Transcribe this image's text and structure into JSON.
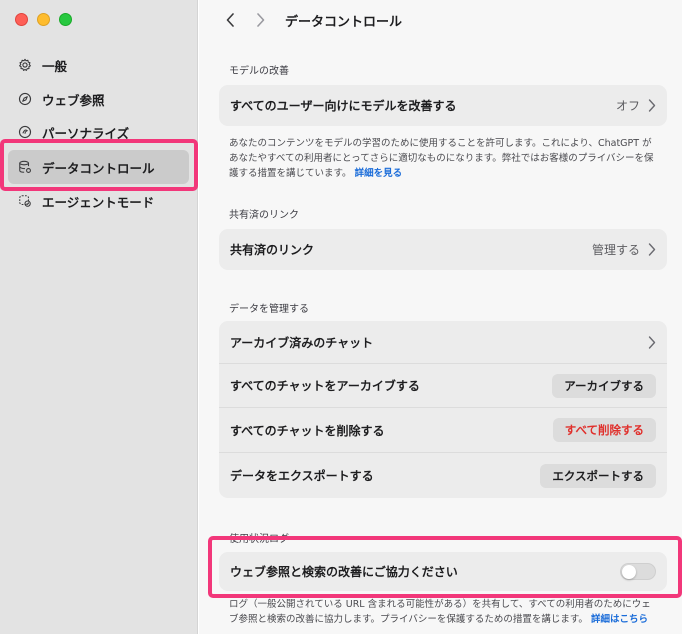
{
  "sidebar": {
    "items": [
      {
        "label": "一般",
        "icon": "gear-icon"
      },
      {
        "label": "ウェブ参照",
        "icon": "compass-icon"
      },
      {
        "label": "パーソナライズ",
        "icon": "personalize-icon"
      },
      {
        "label": "データコントロール",
        "icon": "database-gear-icon"
      },
      {
        "label": "エージェントモード",
        "icon": "agent-icon"
      }
    ]
  },
  "header": {
    "title": "データコントロール"
  },
  "model": {
    "section_label": "モデルの改善",
    "row_label": "すべてのユーザー向けにモデルを改善する",
    "row_value": "オフ",
    "desc": "あなたのコンテンツをモデルの学習のために使用することを許可します。これにより、ChatGPT があなたやすべての利用者にとってさらに適切なものになります。弊社ではお客様のプライバシーを保護する措置を講じています。",
    "link": "詳細を見る"
  },
  "shared": {
    "section_label": "共有済のリンク",
    "row_label": "共有済のリンク",
    "row_value": "管理する"
  },
  "manage": {
    "section_label": "データを管理する",
    "archived_label": "アーカイブ済みのチャット",
    "archive_all_label": "すべてのチャットをアーカイブする",
    "archive_all_button": "アーカイブする",
    "delete_all_label": "すべてのチャットを削除する",
    "delete_all_button": "すべて削除する",
    "export_label": "データをエクスポートする",
    "export_button": "エクスポートする"
  },
  "usage": {
    "section_label": "使用状況ログ",
    "row_label": "ウェブ参照と検索の改善にご協力ください",
    "toggle_on": false,
    "desc": "ログ（一般公開されている URL 含まれる可能性がある）を共有して、すべての利用者のためにウェブ参照と検索の改善に協力します。プライバシーを保護するための措置を講じます。",
    "link": "詳細はこちら"
  },
  "colors": {
    "highlight": "#f2377a",
    "danger": "#e0302c",
    "link": "#1a6cd9"
  }
}
